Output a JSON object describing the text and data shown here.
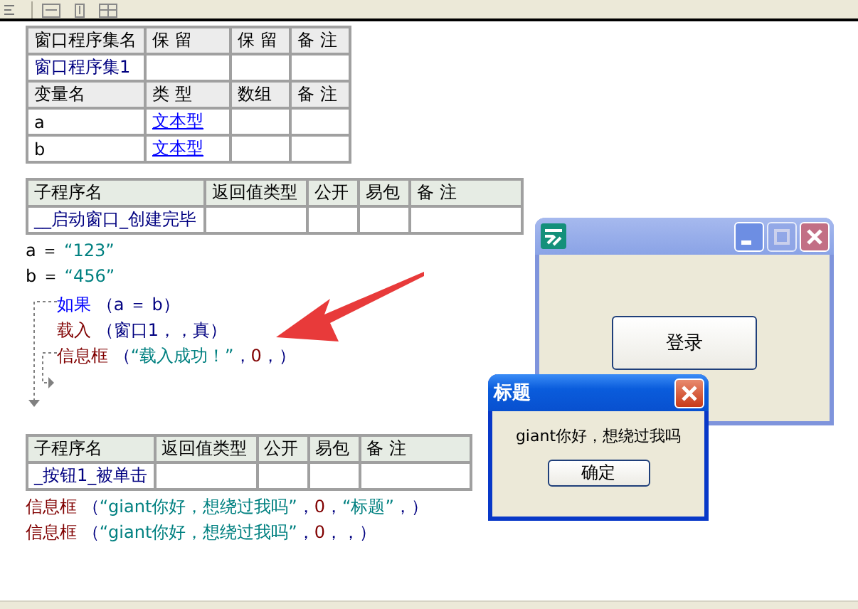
{
  "assembly_table": {
    "columns": [
      "窗口程序集名",
      "保 留",
      "保 留",
      "备 注"
    ],
    "name": "窗口程序集1"
  },
  "variable_table": {
    "columns": [
      "变量名",
      "类 型",
      "数组",
      "备 注"
    ],
    "rows": [
      {
        "name": "a",
        "type": "文本型"
      },
      {
        "name": "b",
        "type": "文本型"
      }
    ]
  },
  "subroutines": [
    {
      "columns": [
        "子程序名",
        "返回值类型",
        "公开",
        "易包",
        "备 注"
      ],
      "name": "__启动窗口_创建完毕",
      "lines": [
        {
          "kind": "code",
          "segments": [
            {
              "kind": "var",
              "text": "a ＝ "
            },
            {
              "kind": "string",
              "text": "“123”"
            }
          ]
        },
        {
          "kind": "code",
          "segments": [
            {
              "kind": "var",
              "text": "b ＝ "
            },
            {
              "kind": "string",
              "text": "“456”"
            }
          ]
        },
        {
          "kind": "if_block",
          "children": [
            {
              "kind": "code",
              "segments": [
                {
                  "kind": "keyword",
                  "text": "如果 "
                },
                {
                  "kind": "punct",
                  "text": "（a ＝ b）"
                }
              ]
            },
            {
              "kind": "code",
              "segments": [
                {
                  "kind": "command",
                  "text": "载入 "
                },
                {
                  "kind": "punct",
                  "text": "（窗口1，，真）"
                }
              ]
            },
            {
              "kind": "code",
              "segments": [
                {
                  "kind": "command",
                  "text": "信息框 "
                },
                {
                  "kind": "punct",
                  "text": "（"
                },
                {
                  "kind": "string",
                  "text": "“载入成功！”"
                },
                {
                  "kind": "punct",
                  "text": "，"
                },
                {
                  "kind": "number",
                  "text": "0"
                },
                {
                  "kind": "punct",
                  "text": "，）"
                }
              ]
            }
          ]
        }
      ]
    },
    {
      "columns": [
        "子程序名",
        "返回值类型",
        "公开",
        "易包",
        "备 注"
      ],
      "name": "_按钮1_被单击",
      "lines": [
        {
          "kind": "code",
          "segments": [
            {
              "kind": "command",
              "text": "信息框 "
            },
            {
              "kind": "punct",
              "text": "（"
            },
            {
              "kind": "string",
              "text": "“giant你好，想绕过我吗”"
            },
            {
              "kind": "punct",
              "text": "，"
            },
            {
              "kind": "number",
              "text": "0"
            },
            {
              "kind": "punct",
              "text": "，"
            },
            {
              "kind": "string",
              "text": "“标题”"
            },
            {
              "kind": "punct",
              "text": "，）"
            }
          ]
        },
        {
          "kind": "code",
          "segments": [
            {
              "kind": "command",
              "text": "信息框 "
            },
            {
              "kind": "punct",
              "text": "（"
            },
            {
              "kind": "string",
              "text": "“giant你好，想绕过我吗”"
            },
            {
              "kind": "punct",
              "text": "，"
            },
            {
              "kind": "number",
              "text": "0"
            },
            {
              "kind": "punct",
              "text": "，，）"
            }
          ]
        }
      ]
    }
  ],
  "main_window": {
    "active": false,
    "button": "登录"
  },
  "message_box": {
    "active": true,
    "title": "标题",
    "message": "giant你好，想绕过我吗",
    "button": "确定"
  }
}
